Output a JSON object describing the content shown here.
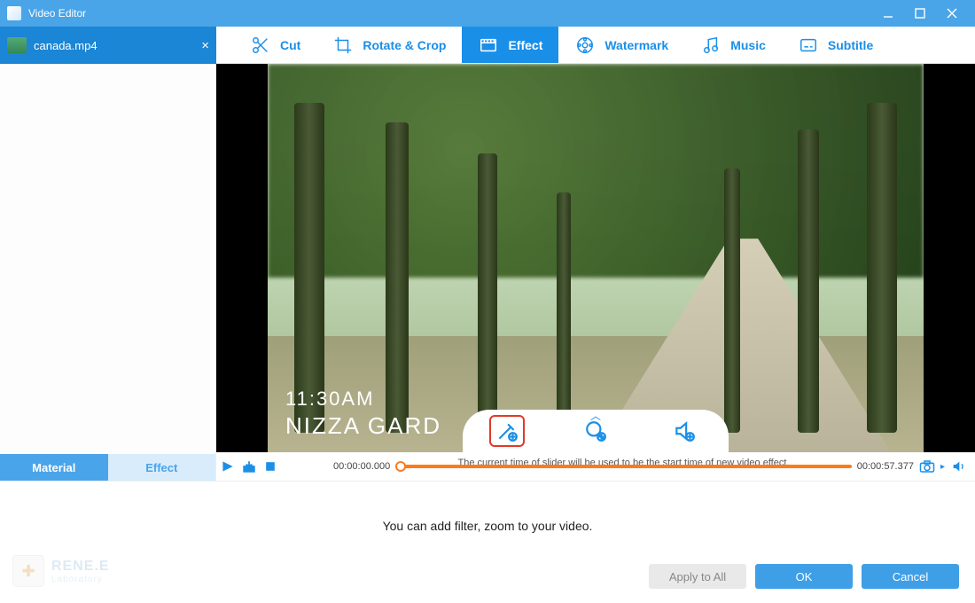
{
  "window": {
    "title": "Video Editor"
  },
  "file_tab": {
    "name": "canada.mp4",
    "close": "×"
  },
  "toolbar": {
    "items": [
      {
        "label": "Cut",
        "icon": "scissors-icon"
      },
      {
        "label": "Rotate & Crop",
        "icon": "crop-icon"
      },
      {
        "label": "Effect",
        "icon": "film-icon",
        "active": true
      },
      {
        "label": "Watermark",
        "icon": "watermark-icon"
      },
      {
        "label": "Music",
        "icon": "music-icon"
      },
      {
        "label": "Subtitle",
        "icon": "subtitle-icon"
      }
    ]
  },
  "sidebar": {
    "tabs": [
      {
        "label": "Material",
        "active": true
      },
      {
        "label": "Effect",
        "active": false
      }
    ]
  },
  "preview": {
    "overlay_time": "11:30AM",
    "overlay_title": "NIZZA GARD"
  },
  "pill": {
    "buttons": [
      {
        "name": "add-effect",
        "highlight": true
      },
      {
        "name": "add-zoom",
        "highlight": false
      },
      {
        "name": "add-audio",
        "highlight": false
      }
    ]
  },
  "timeline": {
    "start": "00:00:00.000",
    "end": "00:00:57.377",
    "hint": "The current time of slider will be used to be the start time of new video effect."
  },
  "bottom": {
    "message": "You can add filter, zoom to your video.",
    "brand_line1": "RENE.E",
    "brand_line2": "Laboratory",
    "buttons": {
      "apply_all": "Apply to All",
      "ok": "OK",
      "cancel": "Cancel"
    }
  }
}
